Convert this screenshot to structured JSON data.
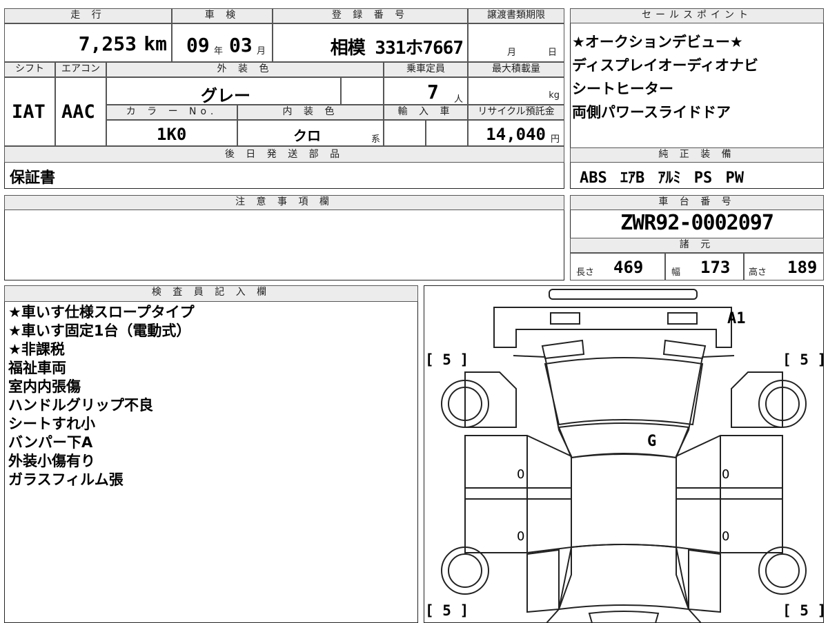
{
  "header": {
    "mileage_label": "走 行",
    "inspection_label": "車 検",
    "registration_label": "登 録 番 号",
    "transfer_deadline_label": "譲渡書類期限",
    "sales_points_label": "セールスポイント"
  },
  "values": {
    "mileage_value": "7,253",
    "mileage_unit": "km",
    "inspection_year": "09",
    "year_unit": "年",
    "inspection_month": "03",
    "month_unit": "月",
    "registration_number": "相模 331ホ7667",
    "transfer_month_unit": "月",
    "transfer_day_unit": "日"
  },
  "row2": {
    "shift_label": "シフト",
    "aircon_label": "エアコン",
    "exterior_color_label": "外 装 色",
    "capacity_label": "乗車定員",
    "max_load_label": "最大積載量",
    "shift_value": "IAT",
    "aircon_value": "AAC",
    "exterior_color_value": "グレー",
    "capacity_value": "7",
    "capacity_unit": "人",
    "load_unit": "kg",
    "color_no_label": "カ ラ ー No.",
    "interior_color_label": "内 装 色",
    "import_label": "輸 入 車",
    "recycle_label": "リサイクル預託金",
    "color_no_value": "1K0",
    "interior_color_value": "クロ",
    "interior_suffix": "系",
    "recycle_value": "14,040",
    "recycle_unit": "円"
  },
  "later_parts": {
    "label": "後 日 発 送 部 品",
    "value": "保証書"
  },
  "sales_points": [
    "★オークションデビュー★",
    "ディスプレイオーディオナビ",
    "シートヒーター",
    "両側パワースライドドア"
  ],
  "genuine_equipment": {
    "label": "純 正 装 備",
    "items": [
      "ABS",
      "ｴｱB",
      "ｱﾙﾐ",
      "PS",
      "PW"
    ]
  },
  "notes": {
    "label": "注 意 事 項 欄"
  },
  "chassis": {
    "label": "車 台 番 号",
    "value": "ZWR92-0002097"
  },
  "specs": {
    "label": "諸 元",
    "length_label": "長さ",
    "length_value": "469",
    "width_label": "幅",
    "width_value": "173",
    "height_label": "高さ",
    "height_value": "189"
  },
  "inspector": {
    "label": "検 査 員 記 入 欄",
    "lines": [
      "★車いす仕様スロープタイプ",
      "★車いす固定1台（電動式）",
      "★非課税",
      "福祉車両",
      "室内内張傷",
      "ハンドルグリップ不良",
      "シートすれ小",
      "バンパー下A",
      "外装小傷有り",
      "ガラスフィルム張"
    ]
  },
  "diagram": {
    "mark_a1": "A1",
    "mark_g": "G",
    "tire_tl": "[ 5 ]",
    "tire_tr": "[ 5 ]",
    "tire_bl": "[ 5 ]",
    "tire_br": "[ 5 ]",
    "zero_1": "0",
    "zero_2": "0",
    "zero_3": "0",
    "zero_4": "0"
  }
}
